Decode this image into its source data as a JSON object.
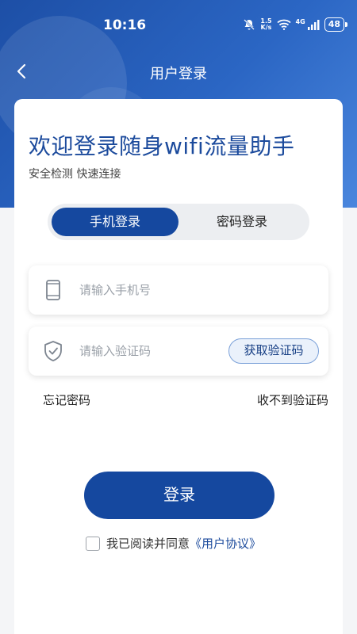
{
  "status_bar": {
    "time": "10:16",
    "net_speed_value": "1.5",
    "net_speed_unit": "K/s",
    "network_type": "4G",
    "battery": "48",
    "icons": [
      "mute-icon",
      "wifi-icon",
      "signal-icon",
      "battery-icon"
    ]
  },
  "header": {
    "title": "用户登录",
    "back_icon": "chevron-left-icon"
  },
  "welcome": {
    "title": "欢迎登录随身wifi流量助手",
    "subtitle": "安全检测 快速连接"
  },
  "tabs": [
    {
      "label": "手机登录",
      "active": true
    },
    {
      "label": "密码登录",
      "active": false
    }
  ],
  "form": {
    "phone": {
      "placeholder": "请输入手机号",
      "value": "",
      "icon": "phone-icon"
    },
    "code": {
      "placeholder": "请输入验证码",
      "value": "",
      "icon": "shield-check-icon"
    },
    "get_code_label": "获取验证码"
  },
  "links": {
    "forgot_password": "忘记密码",
    "no_code": "收不到验证码"
  },
  "login_button": "登录",
  "agreement": {
    "checked": false,
    "text": "我已阅读并同意",
    "link": "《用户协议》"
  },
  "colors": {
    "primary": "#15489f",
    "title": "#1b4a9c",
    "background": "#f4f5f7"
  }
}
